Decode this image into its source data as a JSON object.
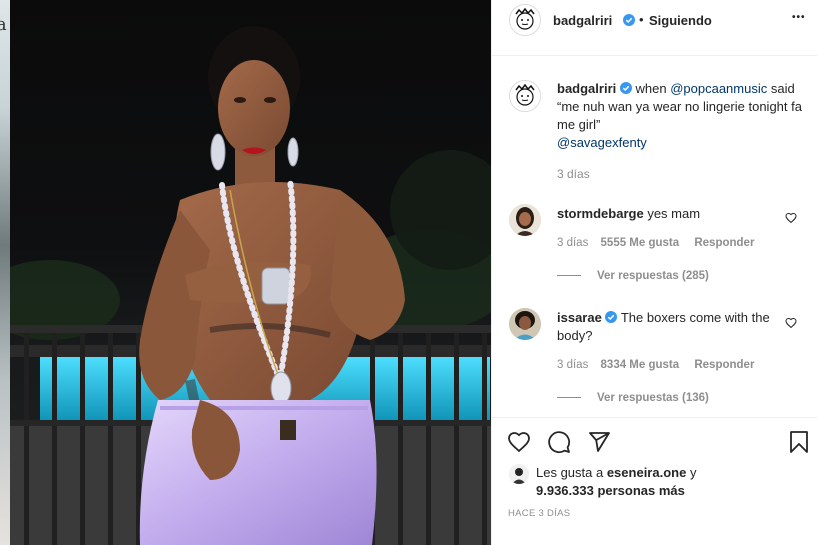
{
  "background_page": {
    "edge_char": "a"
  },
  "header": {
    "username": "badgalriri",
    "separator": "•",
    "follow_status": "Siguiendo",
    "more_options": "•••"
  },
  "caption": {
    "username": "badgalriri",
    "text_before": "when ",
    "mention_1": "@popcaanmusic",
    "text_after": " said “me nuh wan ya wear no lingerie tonight fa me girl”",
    "mention_2": "@savagexfenty",
    "time": "3 días"
  },
  "comments": [
    {
      "username": "stormdebarge",
      "verified": false,
      "text": "yes mam",
      "time": "3 días",
      "likes": "5555 Me gusta",
      "reply": "Responder",
      "view_replies": "Ver respuestas (285)"
    },
    {
      "username": "issarae",
      "verified": true,
      "text": "The boxers come with the body?",
      "time": "3 días",
      "likes": "8334 Me gusta",
      "reply": "Responder",
      "view_replies": "Ver respuestas (136)"
    }
  ],
  "actions": {
    "icons": [
      "heart-icon",
      "comment-icon",
      "share-icon",
      "bookmark-icon"
    ]
  },
  "likes": {
    "prefix": "Les gusta a ",
    "liker": "eseneira.one",
    "suffix": " y",
    "count_text": "9.936.333 personas más"
  },
  "timestamp": "HACE 3 DÍAS",
  "colors": {
    "verified_blue": "#3897f0",
    "link_blue": "#00376b",
    "gray_text": "#8e8e8e",
    "pool_cyan": "#22c3e6",
    "shorts_lavender": "#c9b6ef"
  }
}
